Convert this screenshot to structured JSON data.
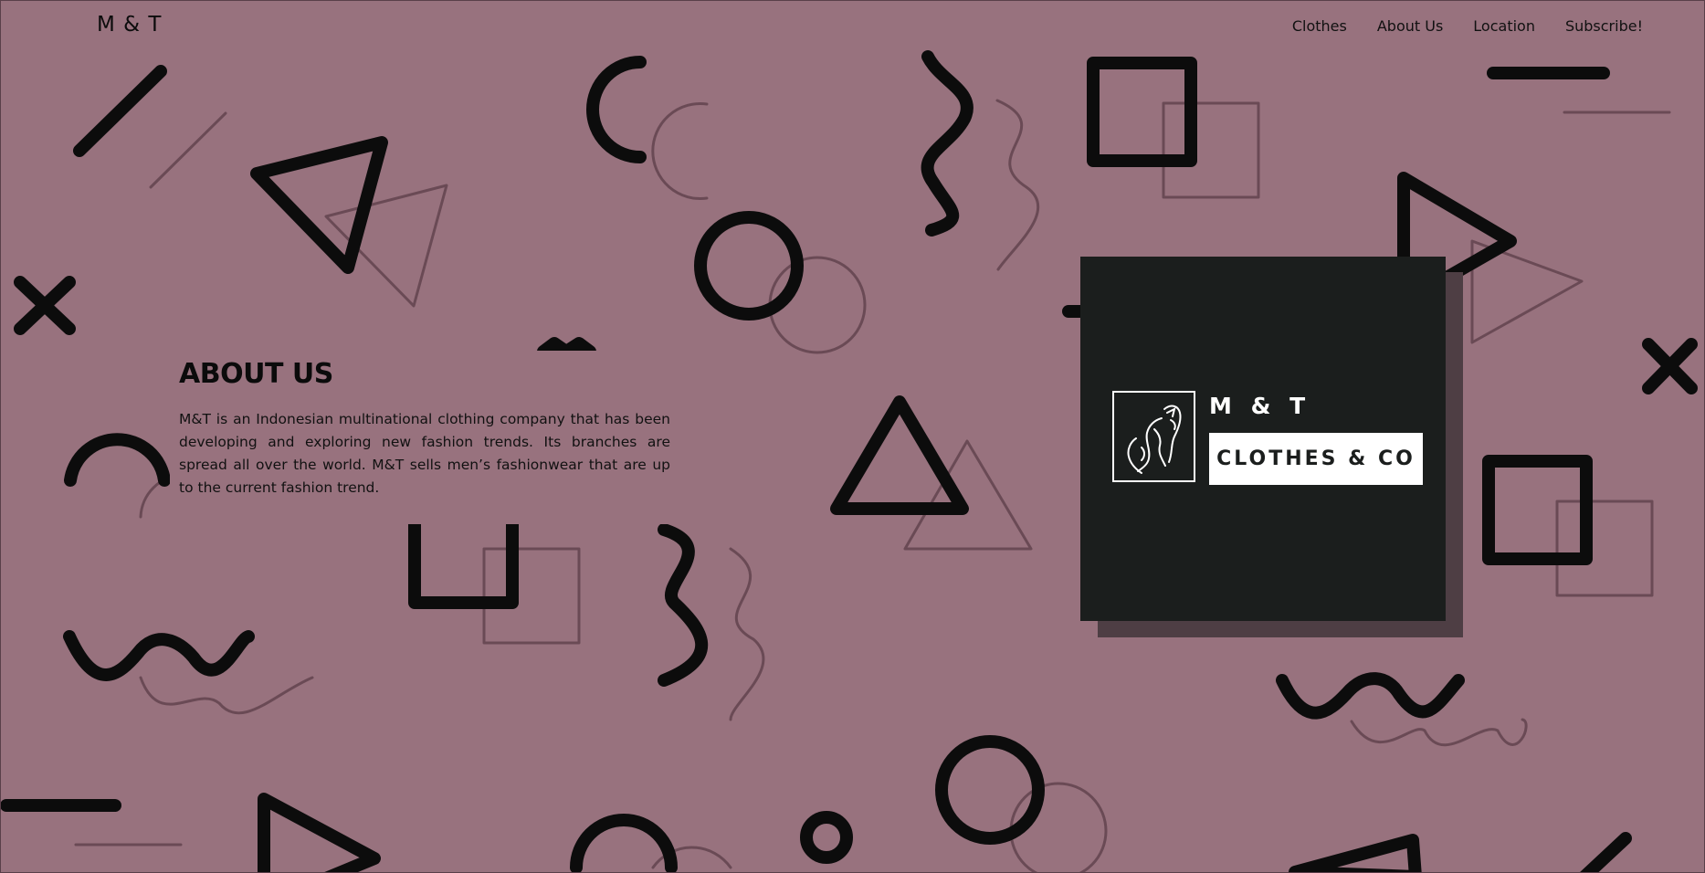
{
  "header": {
    "logo": "M & T",
    "nav": [
      "Clothes",
      "About Us",
      "Location",
      "Subscribe!"
    ]
  },
  "about": {
    "title": "ABOUT US",
    "body": "M&T is an Indonesian multinational clothing company that has been developing and exploring new fashion trends. Its branches are spread all over the world. M&T sells men’s fashionwear that are up to the current fashion trend."
  },
  "brand_card": {
    "name": "M & T",
    "tagline": "CLOTHES & CO",
    "emblem": "wolf-icon"
  },
  "colors": {
    "background": "#98727e",
    "shape_dark": "#0c0c0c",
    "shape_outline": "#6a4a55",
    "card": "#1b1e1d",
    "card_shadow": "#4e3e44"
  }
}
